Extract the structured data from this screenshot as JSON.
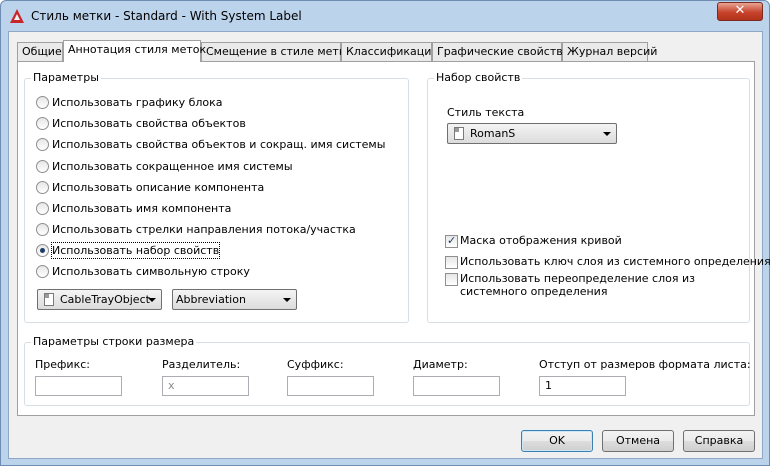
{
  "window": {
    "title": "Стиль метки - Standard - With System Label",
    "close_symbol": "✕"
  },
  "tabs": [
    {
      "label": "Общие",
      "active": false
    },
    {
      "label": "Аннотация стиля меток",
      "active": true
    },
    {
      "label": "Смещение в стиле метки",
      "active": false
    },
    {
      "label": "Классификации",
      "active": false
    },
    {
      "label": "Графические свойства",
      "active": false
    },
    {
      "label": "Журнал версий",
      "active": false
    }
  ],
  "parameters": {
    "legend": "Параметры",
    "options": [
      {
        "label": "Использовать графику блока",
        "checked": false
      },
      {
        "label": "Использовать свойства объектов",
        "checked": false
      },
      {
        "label": "Использовать свойства объектов и сокращ. имя системы",
        "checked": false
      },
      {
        "label": "Использовать сокращенное имя системы",
        "checked": false
      },
      {
        "label": "Использовать описание компонента",
        "checked": false
      },
      {
        "label": "Использовать имя компонента",
        "checked": false
      },
      {
        "label": "Использовать стрелки направления потока/участка",
        "checked": false
      },
      {
        "label": "Использовать набор свойств",
        "checked": true
      },
      {
        "label": "Использовать символьную строку",
        "checked": false
      }
    ],
    "property_set_value": "CableTrayObject",
    "property_value": "Abbreviation"
  },
  "property_set": {
    "legend": "Набор свойств",
    "text_style_label": "Стиль текста",
    "text_style_value": "RomanS",
    "checkboxes": [
      {
        "label": "Маска отображения кривой",
        "checked": true
      },
      {
        "label": "Использовать ключ слоя из системного определения",
        "checked": false
      },
      {
        "label": "Использовать переопределение слоя из системного определения",
        "checked": false
      }
    ]
  },
  "dimension": {
    "legend": "Параметры строки размера",
    "prefix_label": "Префикс:",
    "prefix_value": "",
    "separator_label": "Разделитель:",
    "separator_value": "x",
    "suffix_label": "Суффикс:",
    "suffix_value": "",
    "diameter_label": "Диаметр:",
    "diameter_value": "",
    "offset_label": "Отступ от размеров формата листа:",
    "offset_value": "1"
  },
  "buttons": {
    "ok": "OK",
    "cancel": "Отмена",
    "help": "Справка"
  }
}
